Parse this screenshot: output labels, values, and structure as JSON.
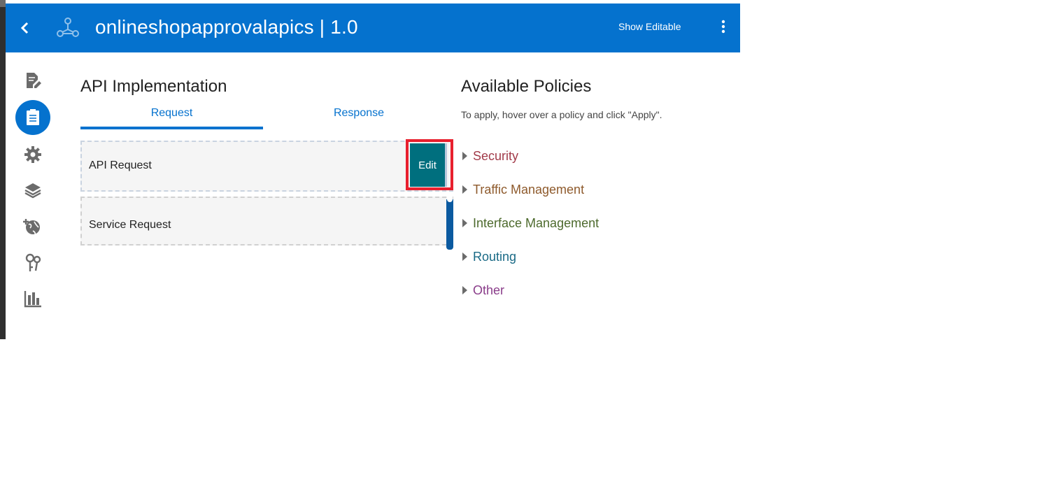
{
  "header": {
    "title": "onlineshopapprovalapics | 1.0",
    "show_editable_label": "Show Editable",
    "background_color": "#0572ce"
  },
  "sidebar": {
    "items": [
      {
        "icon": "document-edit-icon",
        "active": false
      },
      {
        "icon": "clipboard-list-icon",
        "active": true
      },
      {
        "icon": "gear-icon",
        "active": false
      },
      {
        "icon": "layers-icon",
        "active": false
      },
      {
        "icon": "globe-plus-icon",
        "active": false
      },
      {
        "icon": "keys-icon",
        "active": false
      },
      {
        "icon": "bar-chart-icon",
        "active": false
      }
    ]
  },
  "implementation": {
    "title": "API Implementation",
    "tabs": [
      {
        "label": "Request",
        "selected": true
      },
      {
        "label": "Response",
        "selected": false
      }
    ],
    "flow": [
      {
        "label": "API Request"
      },
      {
        "label": "Service Request"
      }
    ],
    "edit_label": "Edit"
  },
  "policies": {
    "title": "Available Policies",
    "hint": "To apply, hover over a policy and click \"Apply\".",
    "groups": [
      {
        "label": "Security",
        "color": "#a23b4a"
      },
      {
        "label": "Traffic Management",
        "color": "#8e5a2c"
      },
      {
        "label": "Interface Management",
        "color": "#4d6a2d"
      },
      {
        "label": "Routing",
        "color": "#1a6a86"
      },
      {
        "label": "Other",
        "color": "#8a3d8a"
      }
    ]
  }
}
